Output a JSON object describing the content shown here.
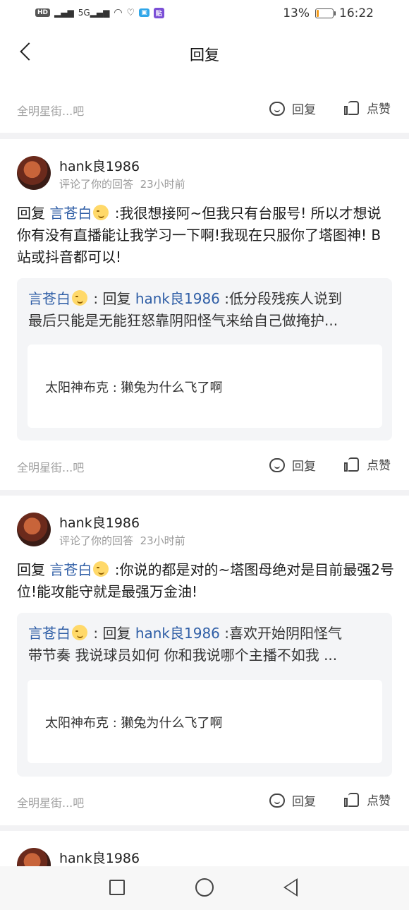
{
  "status_bar": {
    "left_icons": [
      "HD",
      "5G",
      "wifi",
      "heart-pulse",
      "app-blue",
      "app-purple"
    ],
    "battery_percent_text": "13%",
    "battery_level": 0.13,
    "time": "16:22"
  },
  "header": {
    "title": "回复"
  },
  "top_card": {
    "source": "全明星街...吧",
    "reply_label": "回复",
    "like_label": "点赞"
  },
  "cards": [
    {
      "username": "hank良1986",
      "meta_action": "评论了你的回答",
      "meta_time": "23小时前",
      "reply_prefix": "回复",
      "reply_to": "言苍白",
      "text": " :我很想接阿~但我只有台服号! 所以才想说你有没有直播能让我学习一下啊!我现在只服你了塔图神! B站或抖音都可以!",
      "quote": {
        "author": "言苍白",
        "sep": " : 回复 ",
        "target": "hank良1986",
        "text_line1": " :低分段残疾人说到",
        "text_line2": "最后只能是无能狂怒靠阴阳怪气来给自己做掩护...",
        "inner": "太阳神布克 : 獭兔为什么飞了啊"
      },
      "source": "全明星街...吧",
      "reply_label": "回复",
      "like_label": "点赞"
    },
    {
      "username": "hank良1986",
      "meta_action": "评论了你的回答",
      "meta_time": "23小时前",
      "reply_prefix": "回复",
      "reply_to": "言苍白",
      "text": " :你说的都是对的~塔图母绝对是目前最强2号位!能攻能守就是最强万金油!",
      "quote": {
        "author": "言苍白",
        "sep": " : 回复 ",
        "target": "hank良1986",
        "text_line1": " :喜欢开始阴阳怪气",
        "text_line2": "带节奏 我说球员如何 你和我说哪个主播不如我 ...",
        "inner": "太阳神布克 : 獭兔为什么飞了啊"
      },
      "source": "全明星街...吧",
      "reply_label": "回复",
      "like_label": "点赞"
    },
    {
      "username": "hank良1986"
    }
  ],
  "bottom_nav": [
    "square",
    "circle",
    "back-triangle"
  ]
}
